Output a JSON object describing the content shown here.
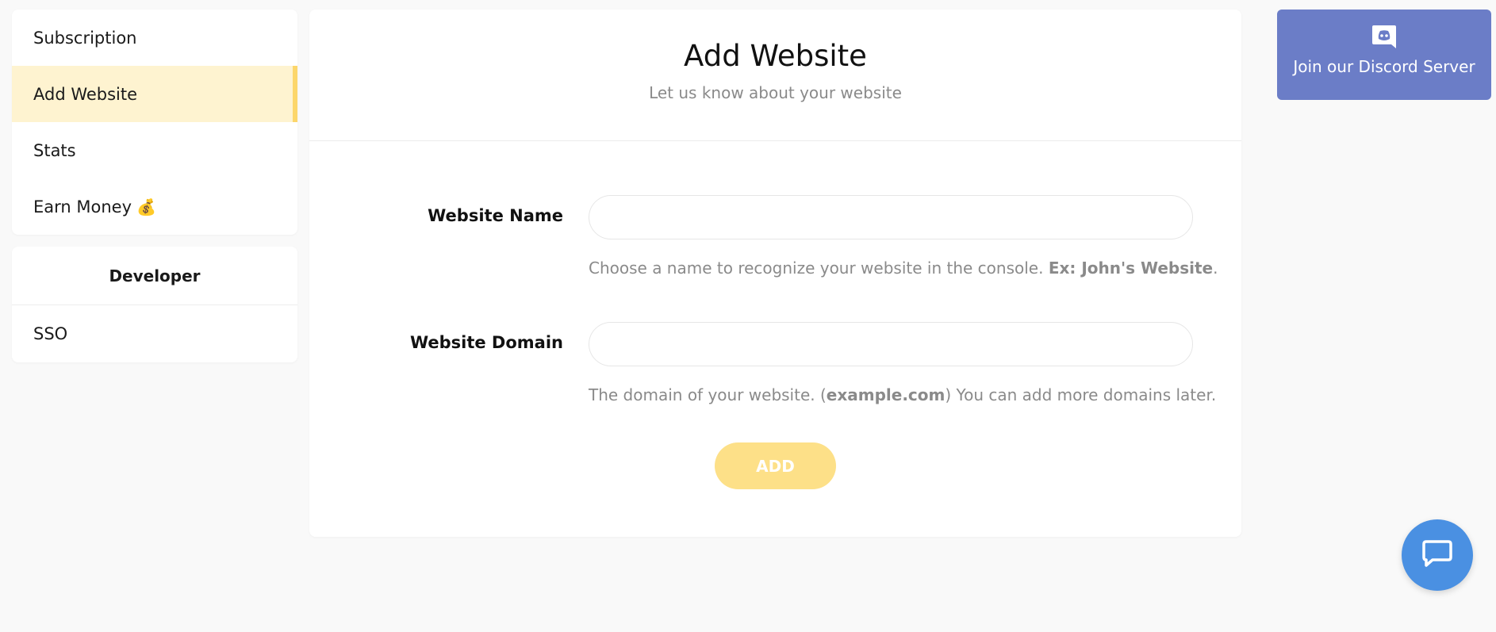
{
  "sidebar": {
    "items": [
      {
        "label": "Subscription"
      },
      {
        "label": "Add Website",
        "active": true
      },
      {
        "label": "Stats"
      },
      {
        "label": "Earn Money",
        "emoji": "💰"
      }
    ],
    "developer": {
      "heading": "Developer",
      "items": [
        {
          "label": "SSO"
        }
      ]
    }
  },
  "main": {
    "title": "Add Website",
    "subtitle": "Let us know about your website",
    "form": {
      "name": {
        "label": "Website Name",
        "value": "",
        "help_prefix": "Choose a name to recognize your website in the console. ",
        "help_bold": "Ex: John's Website",
        "help_suffix": "."
      },
      "domain": {
        "label": "Website Domain",
        "value": "",
        "help_prefix": "The domain of your website. (",
        "help_bold": "example.com",
        "help_suffix": ") You can add more domains later."
      },
      "submit_label": "ADD"
    }
  },
  "discord": {
    "label": "Join our Discord Server",
    "icon": "discord-icon"
  },
  "chat": {
    "icon": "chat-bubble-icon"
  },
  "colors": {
    "accent": "#fcd66b",
    "active_bg": "#fef3d0",
    "add_button": "#fde088",
    "discord": "#6b7dc7",
    "chat": "#4a90e2"
  }
}
